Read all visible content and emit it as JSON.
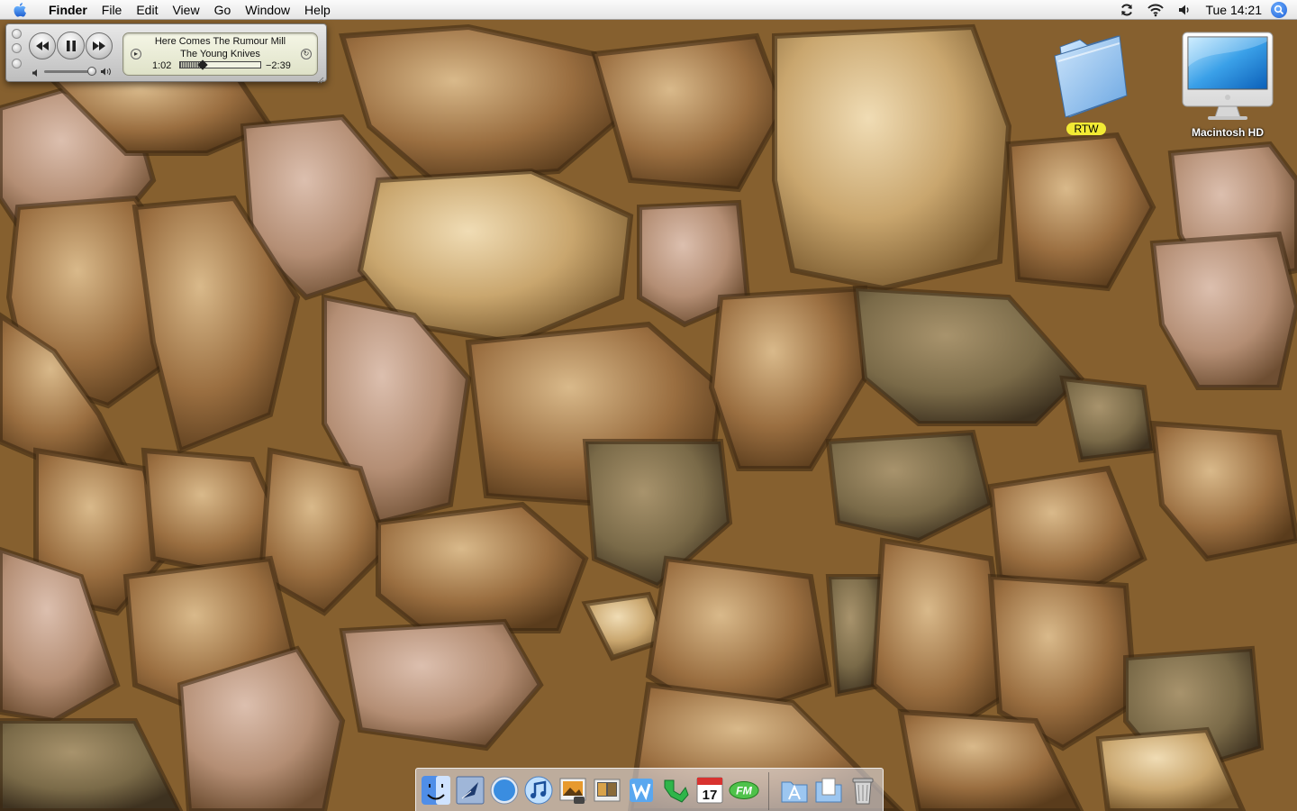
{
  "menubar": {
    "apple_icon": "apple-logo-icon",
    "app_name": "Finder",
    "menus": [
      "File",
      "Edit",
      "View",
      "Go",
      "Window",
      "Help"
    ],
    "status_icons": [
      "sync-icon",
      "wifi-icon",
      "volume-icon"
    ],
    "clock": "Tue 14:21",
    "spotlight_icon": "spotlight-search-icon"
  },
  "itunes": {
    "track_title": "Here Comes The Rumour Mill",
    "artist": "The Young Knives",
    "elapsed": "1:02",
    "remaining": "−2:39",
    "progress_fraction": 0.28,
    "volume_fraction": 0.92,
    "playing": true,
    "lcd_color": "#e8ead2"
  },
  "desktop_icons": [
    {
      "label": "RTW",
      "icon": "folder-icon",
      "label_color": "#f2ea34"
    },
    {
      "label": "Macintosh HD",
      "icon": "imac-drive-icon"
    }
  ],
  "dock": {
    "apps": [
      "finder-icon",
      "mail-icon",
      "safari-icon",
      "itunes-icon",
      "iphoto-icon",
      "imovie-icon",
      "iweb-icon",
      "ichat-icon",
      "ical-icon",
      "fm-radio-icon"
    ],
    "ical_day": "17",
    "fm_label": "FM",
    "stacks": [
      "applications-folder-icon",
      "documents-folder-icon",
      "trash-icon"
    ]
  }
}
